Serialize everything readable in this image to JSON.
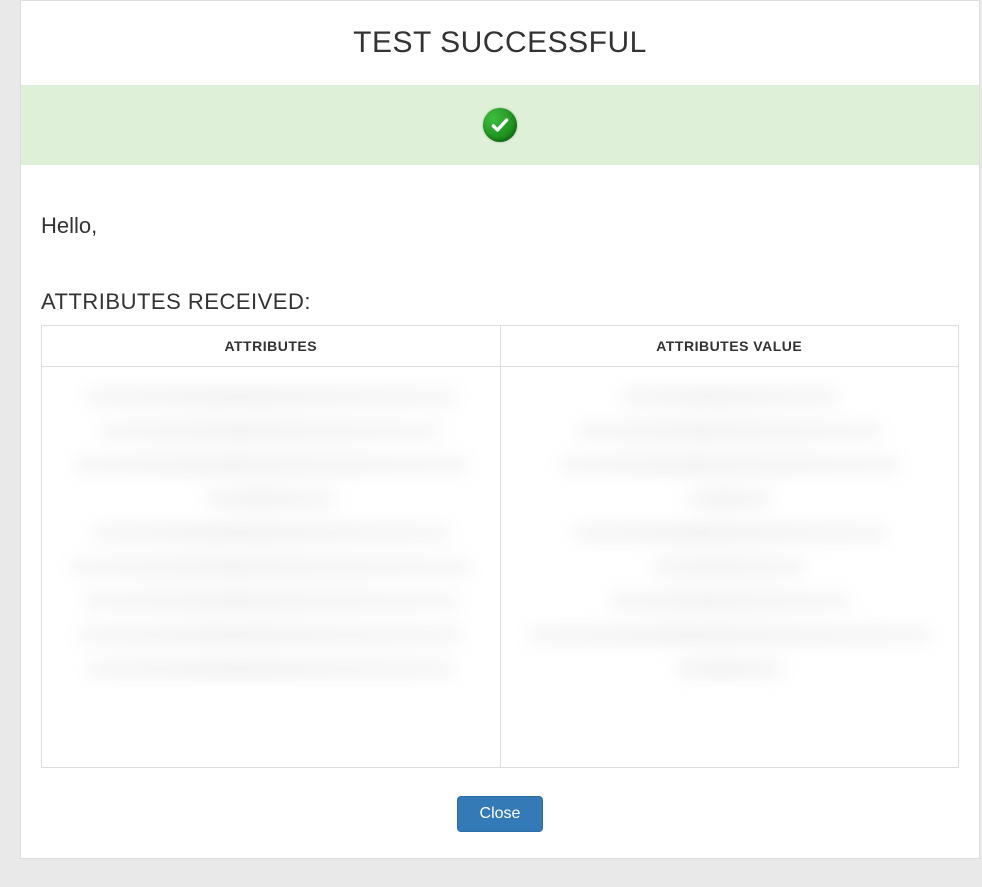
{
  "title": "TEST SUCCESSFUL",
  "greeting": "Hello,",
  "attributes_heading": "ATTRIBUTES RECEIVED:",
  "table": {
    "columns": [
      "ATTRIBUTES",
      "ATTRIBUTES VALUE"
    ]
  },
  "footer": {
    "close_label": "Close"
  }
}
